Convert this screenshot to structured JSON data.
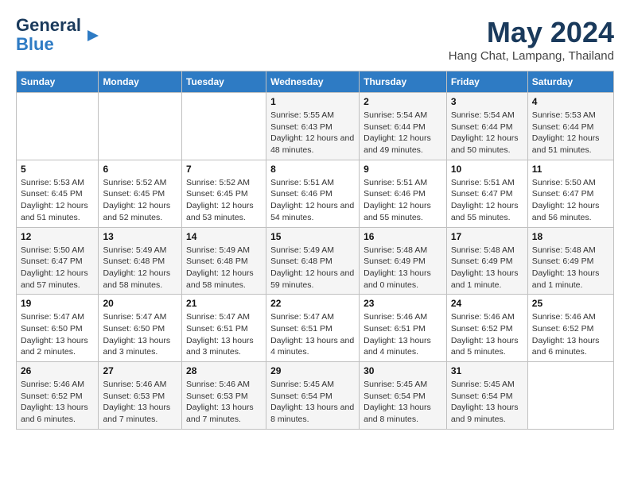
{
  "header": {
    "logo_line1": "General",
    "logo_line2": "Blue",
    "month_year": "May 2024",
    "location": "Hang Chat, Lampang, Thailand"
  },
  "weekdays": [
    "Sunday",
    "Monday",
    "Tuesday",
    "Wednesday",
    "Thursday",
    "Friday",
    "Saturday"
  ],
  "weeks": [
    [
      {
        "day": "",
        "sunrise": "",
        "sunset": "",
        "daylight": ""
      },
      {
        "day": "",
        "sunrise": "",
        "sunset": "",
        "daylight": ""
      },
      {
        "day": "",
        "sunrise": "",
        "sunset": "",
        "daylight": ""
      },
      {
        "day": "1",
        "sunrise": "Sunrise: 5:55 AM",
        "sunset": "Sunset: 6:43 PM",
        "daylight": "Daylight: 12 hours and 48 minutes."
      },
      {
        "day": "2",
        "sunrise": "Sunrise: 5:54 AM",
        "sunset": "Sunset: 6:44 PM",
        "daylight": "Daylight: 12 hours and 49 minutes."
      },
      {
        "day": "3",
        "sunrise": "Sunrise: 5:54 AM",
        "sunset": "Sunset: 6:44 PM",
        "daylight": "Daylight: 12 hours and 50 minutes."
      },
      {
        "day": "4",
        "sunrise": "Sunrise: 5:53 AM",
        "sunset": "Sunset: 6:44 PM",
        "daylight": "Daylight: 12 hours and 51 minutes."
      }
    ],
    [
      {
        "day": "5",
        "sunrise": "Sunrise: 5:53 AM",
        "sunset": "Sunset: 6:45 PM",
        "daylight": "Daylight: 12 hours and 51 minutes."
      },
      {
        "day": "6",
        "sunrise": "Sunrise: 5:52 AM",
        "sunset": "Sunset: 6:45 PM",
        "daylight": "Daylight: 12 hours and 52 minutes."
      },
      {
        "day": "7",
        "sunrise": "Sunrise: 5:52 AM",
        "sunset": "Sunset: 6:45 PM",
        "daylight": "Daylight: 12 hours and 53 minutes."
      },
      {
        "day": "8",
        "sunrise": "Sunrise: 5:51 AM",
        "sunset": "Sunset: 6:46 PM",
        "daylight": "Daylight: 12 hours and 54 minutes."
      },
      {
        "day": "9",
        "sunrise": "Sunrise: 5:51 AM",
        "sunset": "Sunset: 6:46 PM",
        "daylight": "Daylight: 12 hours and 55 minutes."
      },
      {
        "day": "10",
        "sunrise": "Sunrise: 5:51 AM",
        "sunset": "Sunset: 6:47 PM",
        "daylight": "Daylight: 12 hours and 55 minutes."
      },
      {
        "day": "11",
        "sunrise": "Sunrise: 5:50 AM",
        "sunset": "Sunset: 6:47 PM",
        "daylight": "Daylight: 12 hours and 56 minutes."
      }
    ],
    [
      {
        "day": "12",
        "sunrise": "Sunrise: 5:50 AM",
        "sunset": "Sunset: 6:47 PM",
        "daylight": "Daylight: 12 hours and 57 minutes."
      },
      {
        "day": "13",
        "sunrise": "Sunrise: 5:49 AM",
        "sunset": "Sunset: 6:48 PM",
        "daylight": "Daylight: 12 hours and 58 minutes."
      },
      {
        "day": "14",
        "sunrise": "Sunrise: 5:49 AM",
        "sunset": "Sunset: 6:48 PM",
        "daylight": "Daylight: 12 hours and 58 minutes."
      },
      {
        "day": "15",
        "sunrise": "Sunrise: 5:49 AM",
        "sunset": "Sunset: 6:48 PM",
        "daylight": "Daylight: 12 hours and 59 minutes."
      },
      {
        "day": "16",
        "sunrise": "Sunrise: 5:48 AM",
        "sunset": "Sunset: 6:49 PM",
        "daylight": "Daylight: 13 hours and 0 minutes."
      },
      {
        "day": "17",
        "sunrise": "Sunrise: 5:48 AM",
        "sunset": "Sunset: 6:49 PM",
        "daylight": "Daylight: 13 hours and 1 minute."
      },
      {
        "day": "18",
        "sunrise": "Sunrise: 5:48 AM",
        "sunset": "Sunset: 6:49 PM",
        "daylight": "Daylight: 13 hours and 1 minute."
      }
    ],
    [
      {
        "day": "19",
        "sunrise": "Sunrise: 5:47 AM",
        "sunset": "Sunset: 6:50 PM",
        "daylight": "Daylight: 13 hours and 2 minutes."
      },
      {
        "day": "20",
        "sunrise": "Sunrise: 5:47 AM",
        "sunset": "Sunset: 6:50 PM",
        "daylight": "Daylight: 13 hours and 3 minutes."
      },
      {
        "day": "21",
        "sunrise": "Sunrise: 5:47 AM",
        "sunset": "Sunset: 6:51 PM",
        "daylight": "Daylight: 13 hours and 3 minutes."
      },
      {
        "day": "22",
        "sunrise": "Sunrise: 5:47 AM",
        "sunset": "Sunset: 6:51 PM",
        "daylight": "Daylight: 13 hours and 4 minutes."
      },
      {
        "day": "23",
        "sunrise": "Sunrise: 5:46 AM",
        "sunset": "Sunset: 6:51 PM",
        "daylight": "Daylight: 13 hours and 4 minutes."
      },
      {
        "day": "24",
        "sunrise": "Sunrise: 5:46 AM",
        "sunset": "Sunset: 6:52 PM",
        "daylight": "Daylight: 13 hours and 5 minutes."
      },
      {
        "day": "25",
        "sunrise": "Sunrise: 5:46 AM",
        "sunset": "Sunset: 6:52 PM",
        "daylight": "Daylight: 13 hours and 6 minutes."
      }
    ],
    [
      {
        "day": "26",
        "sunrise": "Sunrise: 5:46 AM",
        "sunset": "Sunset: 6:52 PM",
        "daylight": "Daylight: 13 hours and 6 minutes."
      },
      {
        "day": "27",
        "sunrise": "Sunrise: 5:46 AM",
        "sunset": "Sunset: 6:53 PM",
        "daylight": "Daylight: 13 hours and 7 minutes."
      },
      {
        "day": "28",
        "sunrise": "Sunrise: 5:46 AM",
        "sunset": "Sunset: 6:53 PM",
        "daylight": "Daylight: 13 hours and 7 minutes."
      },
      {
        "day": "29",
        "sunrise": "Sunrise: 5:45 AM",
        "sunset": "Sunset: 6:54 PM",
        "daylight": "Daylight: 13 hours and 8 minutes."
      },
      {
        "day": "30",
        "sunrise": "Sunrise: 5:45 AM",
        "sunset": "Sunset: 6:54 PM",
        "daylight": "Daylight: 13 hours and 8 minutes."
      },
      {
        "day": "31",
        "sunrise": "Sunrise: 5:45 AM",
        "sunset": "Sunset: 6:54 PM",
        "daylight": "Daylight: 13 hours and 9 minutes."
      },
      {
        "day": "",
        "sunrise": "",
        "sunset": "",
        "daylight": ""
      }
    ]
  ]
}
